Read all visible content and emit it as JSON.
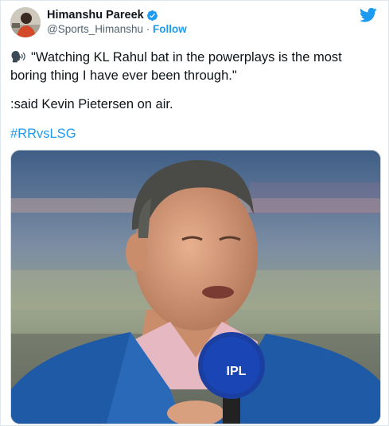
{
  "tweet": {
    "author": {
      "display_name": "Himanshu Pareek",
      "handle": "@Sports_Himanshu",
      "separator": " · ",
      "follow_label": "Follow",
      "verified": true,
      "avatar_icon": "avatar-photo"
    },
    "platform_icon": "twitter-bird-icon",
    "text": {
      "speaking_emoji": "speaking-head-icon",
      "quote_line1": "\"Watching KL Rahul bat in the powerplays is the most",
      "quote_line2": "boring thing I have ever been through.\"",
      "attribution": ":said Kevin Pietersen on air.",
      "hashtag": "#RRvsLSG"
    },
    "media": {
      "microphone_text": "IPL"
    }
  },
  "colors": {
    "accent": "#1d9bf0",
    "text": "#0f1419",
    "secondary": "#536471",
    "border": "#cfd9de"
  }
}
